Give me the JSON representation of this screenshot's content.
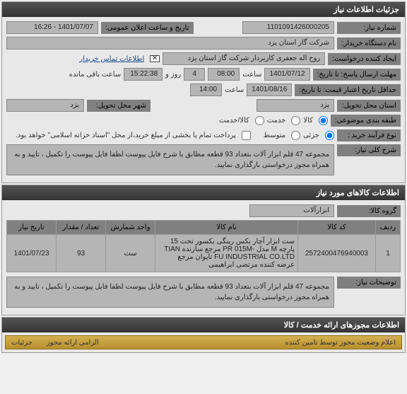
{
  "panel1": {
    "title": "جزئیات اطلاعات نیاز",
    "need_number_label": "شماره نیاز:",
    "need_number": "1101091426000205",
    "datetime_label": "تاریخ و ساعت اعلان عمومی:",
    "datetime": "1401/07/07 - 16:26",
    "buyer_label": "نام دستگاه خریدار:",
    "buyer": "شرکت گاز استان یزد",
    "creator_label": "ایجاد کننده درخواست:",
    "creator": "روح اله جعفری کاربردار شرکت گاز استان یزد",
    "contact_link": "اطلاعات تماس خریدار",
    "deadline_label": "مهلت ارسال پاسخ: تا تاریخ:",
    "deadline_date": "1401/07/12",
    "time_label": "ساعت",
    "deadline_time": "08:00",
    "days_count": "4",
    "days_label": "روز و",
    "remaining_time": "15:22:38",
    "remaining_label": "ساعت باقی مانده",
    "validity_label": "حداقل تاریخ اعتبار قیمت: تا تاریخ:",
    "validity_date": "1401/08/16",
    "validity_time": "14:00",
    "province_label": "استان محل تحویل:",
    "province": "یزد",
    "city_label": "شهر محل تحویل:",
    "city": "یزد",
    "category_label": "طبقه بندی موضوعی:",
    "cat_goods": "کالا",
    "cat_service": "خدمت",
    "cat_goods_service": "کالا/خدمت",
    "process_label": "نوع فرآیند خرید :",
    "proc_partial": "جزئی",
    "proc_medium": "متوسط",
    "payment_note": "پرداخت تمام یا بخشی از مبلغ خرید،از محل \"اسناد خزانه اسلامی\" خواهد بود.",
    "title_label": "شرح کلی نیاز:",
    "title_text": "مجموعه 47 قلم  ابزار آلات بتعداد 93 قطعه مطابق با شرح فایل پیوست لطفا فایل پیوست را تکمیل ، تایید و به همراه مجوز درخواستی بارگذاری نمایید."
  },
  "panel2": {
    "title": "اطلاعات کالاهای مورد نیاز",
    "group_label": "گروه کالا:",
    "group_value": "ابزارآلات",
    "table": {
      "headers": {
        "row": "ردیف",
        "code": "کد کالا",
        "name": "نام کالا",
        "unit": "واحد شمارش",
        "qty": "تعداد / مقدار",
        "date": "تاریخ نیاز"
      },
      "rows": [
        {
          "idx": "1",
          "code": "2572400476940003",
          "name": "ست ابزار آچار بکس رینگی بکسور تخت 15 پارچه M مدل -PR 015M مرجع سازنده TIAN FU INDUSTRIAL CO.LTD تایوان مرجع عرضه کننده مرتضی ابراهیمی",
          "unit": "ست",
          "qty": "93",
          "date": "1401/07/23"
        }
      ]
    },
    "notes_label": "توضیحات نیاز:",
    "notes_text": "مجموعه 47 قلم  ابزار آلات بتعداد 93 قطعه مطابق با شرح فایل پیوست لطفا فایل پیوست را تکمیل ، تایید و به همراه مجوز درخواستی بارگذاری نمایید."
  },
  "panel3": {
    "title": "اطلاعات مجوزهای ارائه خدمت / کالا",
    "status_header": "اعلام وضعیت مجوز توسط تامین کننده",
    "col1": "الزامی ارائه مجوز",
    "col2": "جزئیات"
  }
}
